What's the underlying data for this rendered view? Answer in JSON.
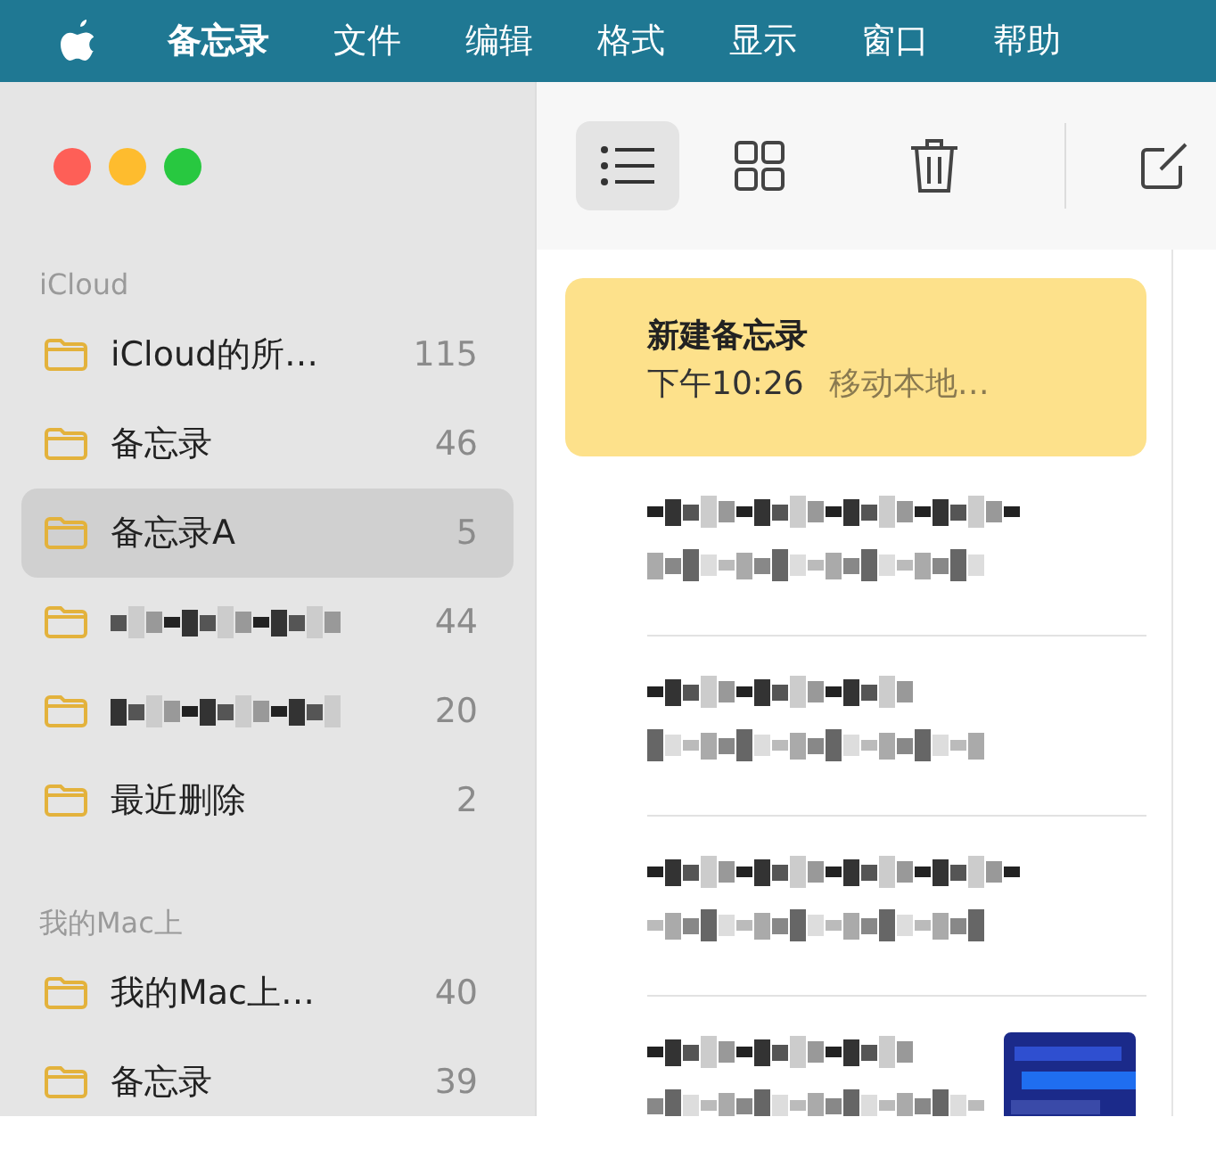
{
  "menu_bar": {
    "items": [
      "备忘录",
      "文件",
      "编辑",
      "格式",
      "显示",
      "窗口",
      "帮助"
    ]
  },
  "toolbar": {
    "view_buttons": [
      {
        "kind": "list",
        "selected": true
      },
      {
        "kind": "gallery",
        "selected": false
      }
    ]
  },
  "sidebar": {
    "sections": [
      {
        "header": "iCloud",
        "folders": [
          {
            "kind": "folder",
            "name": "iCloud的所…",
            "count": "115",
            "selected": false
          },
          {
            "kind": "folder",
            "name": "备忘录",
            "count": "46",
            "selected": false
          },
          {
            "kind": "folder",
            "name": "备忘录A",
            "count": "5",
            "selected": true
          },
          {
            "kind": "redacted",
            "count": "44",
            "selected": false
          },
          {
            "kind": "redacted",
            "count": "20",
            "selected": false
          },
          {
            "kind": "folder",
            "name": "最近删除",
            "count": "2",
            "selected": false
          }
        ]
      },
      {
        "header": "我的Mac上",
        "folders": [
          {
            "kind": "folder",
            "name": "我的Mac上…",
            "count": "40",
            "selected": false
          },
          {
            "kind": "folder",
            "name": "备忘录",
            "count": "39",
            "selected": false
          }
        ]
      }
    ]
  },
  "notes": [
    {
      "kind": "note",
      "title": "新建备忘录",
      "time": "下午10:26",
      "preview": "移动本地…",
      "selected": true
    },
    {
      "kind": "redacted",
      "selected": false
    },
    {
      "kind": "redacted",
      "selected": false
    },
    {
      "kind": "redacted",
      "selected": false
    },
    {
      "kind": "redacted",
      "selected": false
    }
  ]
}
